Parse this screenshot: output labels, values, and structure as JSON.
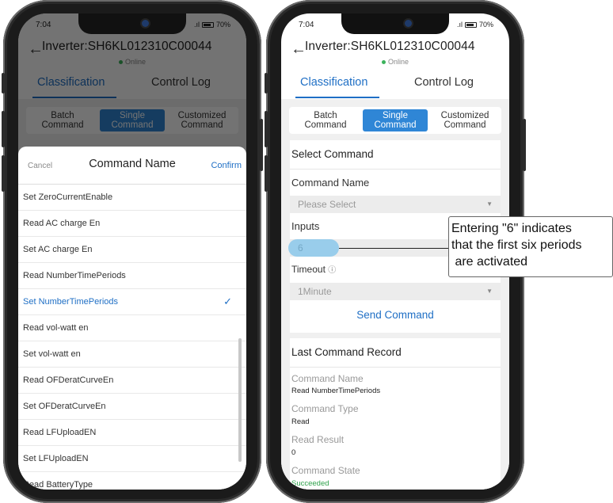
{
  "status_bar": {
    "time": "7:04",
    "battery": "70%"
  },
  "header": {
    "title": "Inverter:SH6KL012310C00044",
    "status": "Online"
  },
  "tabs": [
    {
      "label": "Classification"
    },
    {
      "label": "Control Log"
    }
  ],
  "segments": [
    {
      "line1": "Batch",
      "line2": "Command"
    },
    {
      "line1": "Single",
      "line2": "Command"
    },
    {
      "line1": "Customized",
      "line2": "Command"
    }
  ],
  "picker": {
    "cancel_label": "Cancel",
    "title": "Command Name",
    "confirm_label": "Confirm",
    "items": [
      "Set ZeroCurrentEnable",
      "Read AC charge En",
      "Set AC charge En",
      "Read NumberTimePeriods",
      "Set NumberTimePeriods",
      "Read vol-watt en",
      "Set vol-watt en",
      "Read OFDeratCurveEn",
      "Set OFDeratCurveEn",
      "Read LFUploadEN",
      "Set LFUploadEN",
      "Read BatteryType"
    ],
    "selected_index": 4
  },
  "form": {
    "section_title": "Select Command",
    "command_name_label": "Command Name",
    "command_name_placeholder": "Please Select",
    "inputs_label": "Inputs",
    "inputs_value": "6",
    "timeout_label": "Timeout",
    "timeout_value": "1Minute",
    "send_label": "Send Command"
  },
  "last_record": {
    "section_title": "Last Command Record",
    "command_name_label": "Command Name",
    "command_name_value": "Read NumberTimePeriods",
    "command_type_label": "Command Type",
    "command_type_value": "Read",
    "read_result_label": "Read Result",
    "read_result_value": "0",
    "command_state_label": "Command State",
    "command_state_value": "Succeeded"
  },
  "callout": {
    "line1": "Entering \"6\" indicates",
    "line2": "that the first six periods",
    "line3": " are activated"
  },
  "colors": {
    "accent": "#1f6fc5",
    "segment_active": "#2f86d6",
    "success": "#2fa24b",
    "highlight": "#7ec3eb"
  }
}
